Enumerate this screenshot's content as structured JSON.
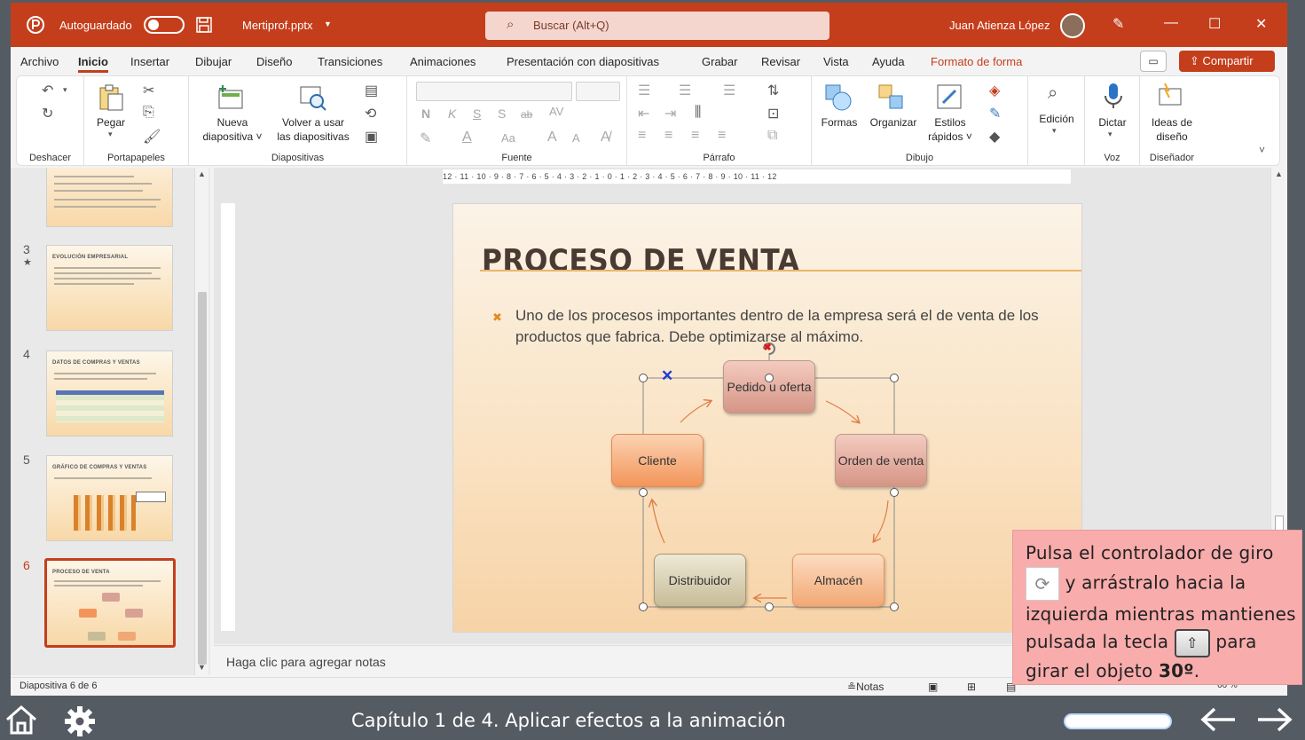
{
  "titlebar": {
    "autosave_label": "Autoguardado",
    "filename": "Mertiprof.pptx",
    "search_placeholder": "Buscar (Alt+Q)",
    "user_name": "Juan Atienza López"
  },
  "tabs": [
    "Archivo",
    "Inicio",
    "Insertar",
    "Dibujar",
    "Diseño",
    "Transiciones",
    "Animaciones",
    "Presentación con diapositivas",
    "Grabar",
    "Revisar",
    "Vista",
    "Ayuda",
    "Formato de forma"
  ],
  "share_label": "Compartir",
  "ribbon": {
    "groups": [
      "Deshacer",
      "Portapapeles",
      "Diapositivas",
      "Fuente",
      "Párrafo",
      "Dibujo",
      "Voz",
      "Diseñador"
    ],
    "paste": "Pegar",
    "new_slide_1": "Nueva",
    "new_slide_2": "diapositiva",
    "reuse_1": "Volver a usar",
    "reuse_2": "las diapositivas",
    "shapes": "Formas",
    "arrange": "Organizar",
    "quick_styles_1": "Estilos",
    "quick_styles_2": "rápidos",
    "editing": "Edición",
    "dictate": "Dictar",
    "ideas_1": "Ideas de",
    "ideas_2": "diseño",
    "font_bold": "N",
    "font_italic": "K",
    "font_underline": "S",
    "font_shadow": "S",
    "font_strike": "ab",
    "font_spacing": "AV",
    "font_case": "Aa",
    "font_grow": "A",
    "font_shrink": "A"
  },
  "thumbnails": [
    {
      "num": "3",
      "title": "EVOLUCIÓN EMPRESARIAL"
    },
    {
      "num": "4",
      "title": "DATOS DE COMPRAS Y VENTAS"
    },
    {
      "num": "5",
      "title": "GRÁFICO DE COMPRAS Y VENTAS"
    },
    {
      "num": "6",
      "title": "PROCESO DE VENTA"
    }
  ],
  "ruler_text": "12 · 11 · 10 · 9 · 8 · 7 · 6 · 5 · 4 · 3 · 2 · 1 · 0 · 1 · 2 · 3 · 4 · 5 · 6 · 7 · 8 · 9 · 10 · 11 · 12",
  "slide": {
    "title": "PROCESO DE VENTA",
    "body": "Uno de los procesos importantes dentro de la empresa será el de venta de los productos que fabrica. Debe optimizarse al máximo.",
    "nodes": {
      "pedido": "Pedido u oferta",
      "orden": "Orden de venta",
      "almacen": "Almacén",
      "distribuidor": "Distribuidor",
      "cliente": "Cliente"
    }
  },
  "notes_placeholder": "Haga clic para agregar notas",
  "status": {
    "slide_counter": "Diapositiva 6 de 6",
    "notes": "Notas",
    "zoom": "66 %"
  },
  "tooltip": {
    "line1": "Pulsa el controlador de giro",
    "line2": "y arrástralo hacia la",
    "line3": "izquierda mientras mantienes",
    "line4a": "pulsada la tecla",
    "line4b": "para",
    "line5a": "girar el objeto",
    "line5b": "30º",
    "line5c": "."
  },
  "player": {
    "chapter": "Capítulo 1 de 4. Aplicar efectos a la animación"
  },
  "colors": {
    "accent": "#c43e1c",
    "tooltip_bg": "#f9acac",
    "player_bg": "#555b63"
  }
}
